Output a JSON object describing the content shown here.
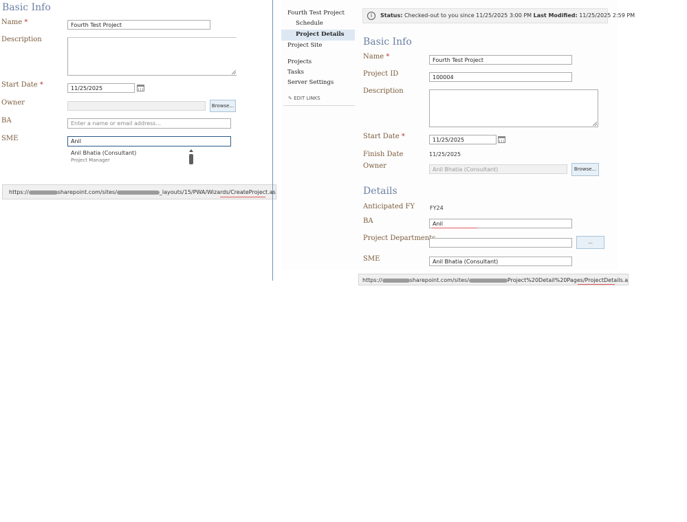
{
  "left": {
    "section_title": "Basic Info",
    "labels": {
      "name": "Name",
      "description": "Description",
      "start_date": "Start Date",
      "owner": "Owner",
      "ba": "BA",
      "sme": "SME"
    },
    "required_mark": "*",
    "name_value": "Fourth Test Project",
    "start_date_value": "11/25/2025",
    "owner_browse": "Browse...",
    "ba_placeholder": "Enter a name or email address...",
    "sme_value": "Anil",
    "suggestion": {
      "name": "Anil Bhatia (Consultant)",
      "title": "Project Manager"
    },
    "status_url": {
      "prefix": "https://",
      "domain": "sharepoint.com/sites/",
      "path": "_layouts/15/PWA/Wizards/",
      "page": "CreateProject.aspx?src"
    }
  },
  "nav": {
    "project": "Fourth Test Project",
    "items": [
      "Schedule",
      "Project Details"
    ],
    "project_site": "Project Site",
    "links": [
      "Projects",
      "Tasks",
      "Server Settings"
    ],
    "edit_links": "EDIT LINKS"
  },
  "right": {
    "status_bar": {
      "status_label": "Status:",
      "status_text": "Checked-out to you since 11/25/2025 3:00 PM",
      "modified_label": "Last Modified:",
      "modified_value": "11/25/2025 2:59 PM"
    },
    "basic_title": "Basic Info",
    "labels": {
      "name": "Name",
      "project_id": "Project ID",
      "description": "Description",
      "start_date": "Start Date",
      "finish_date": "Finish Date",
      "owner": "Owner"
    },
    "required_mark": "*",
    "name_value": "Fourth Test Project",
    "project_id_value": "100004",
    "start_date_value": "11/25/2025",
    "finish_date_value": "11/25/2025",
    "owner_value": "Anil Bhatia (Consultant)",
    "owner_browse": "Browse...",
    "details_title": "Details",
    "detail_labels": {
      "anticipated_fy": "Anticipated FY",
      "ba": "BA",
      "departments": "Project Departments",
      "sme": "SME"
    },
    "anticipated_fy_value": "FY24",
    "ba_value": "Anil",
    "departments_button": "...",
    "sme_value": "Anil Bhatia (Consultant)",
    "status_url": {
      "prefix": "https://",
      "domain": "sharepoint.com/sites/",
      "path": "Project%20Detail%20Pages/",
      "page": "ProjectDetails.aspx?I"
    }
  },
  "colors": {
    "heading": "#6b7fa3",
    "label": "#7a5a3a",
    "required": "#c0392b",
    "nav_selected": "#dde8f3",
    "status_bg": "#f1f1f1"
  }
}
